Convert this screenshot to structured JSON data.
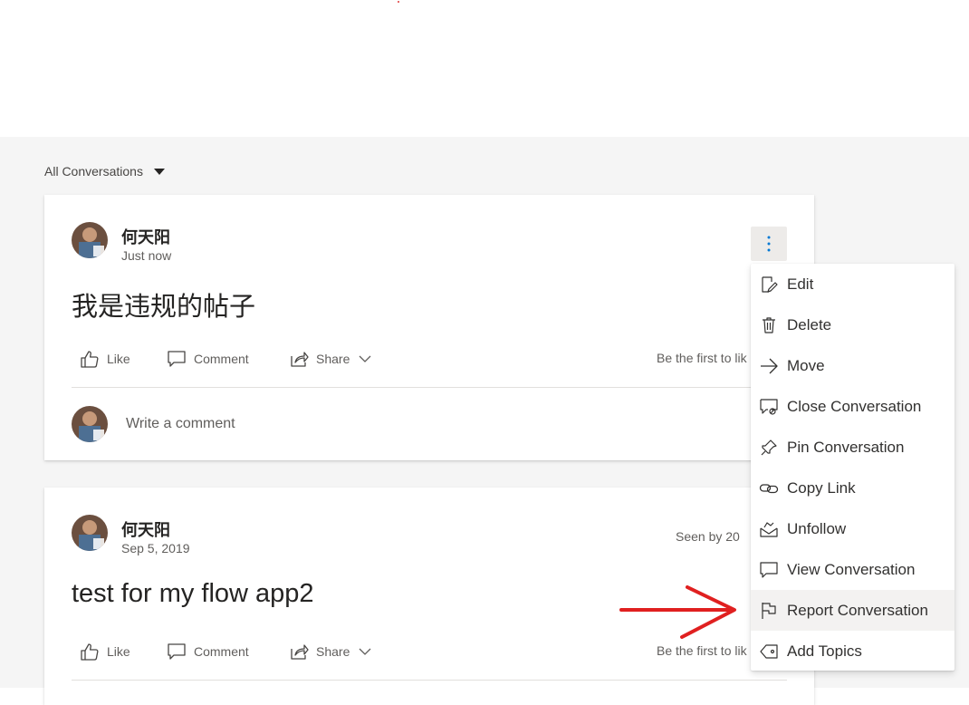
{
  "filter": {
    "label": "All Conversations",
    "icon": "caret-down-icon"
  },
  "posts": [
    {
      "author": "何天阳",
      "time": "Just now",
      "content": "我是违规的帖子",
      "actions": {
        "like": "Like",
        "comment": "Comment",
        "share": "Share"
      },
      "like_status": "Be the first to lik",
      "comment_placeholder": "Write a comment"
    },
    {
      "author": "何天阳",
      "time": "Sep 5, 2019",
      "seen": "Seen by 20",
      "content": "test for my flow app2",
      "actions": {
        "like": "Like",
        "comment": "Comment",
        "share": "Share"
      },
      "like_status": "Be the first to lik"
    }
  ],
  "menu": {
    "items": [
      {
        "label": "Edit",
        "icon": "edit-icon"
      },
      {
        "label": "Delete",
        "icon": "trash-icon"
      },
      {
        "label": "Move",
        "icon": "arrow-right-icon"
      },
      {
        "label": "Close Conversation",
        "icon": "close-conversation-icon"
      },
      {
        "label": "Pin Conversation",
        "icon": "pin-icon"
      },
      {
        "label": "Copy Link",
        "icon": "link-icon"
      },
      {
        "label": "Unfollow",
        "icon": "unfollow-icon"
      },
      {
        "label": "View Conversation",
        "icon": "view-conversation-icon"
      },
      {
        "label": "Report Conversation",
        "icon": "flag-icon",
        "highlighted": true
      },
      {
        "label": "Add Topics",
        "icon": "tag-icon"
      }
    ]
  },
  "colors": {
    "accent": "#0078d4",
    "annotation_arrow": "#e02020",
    "feed_background": "#f5f5f5"
  }
}
